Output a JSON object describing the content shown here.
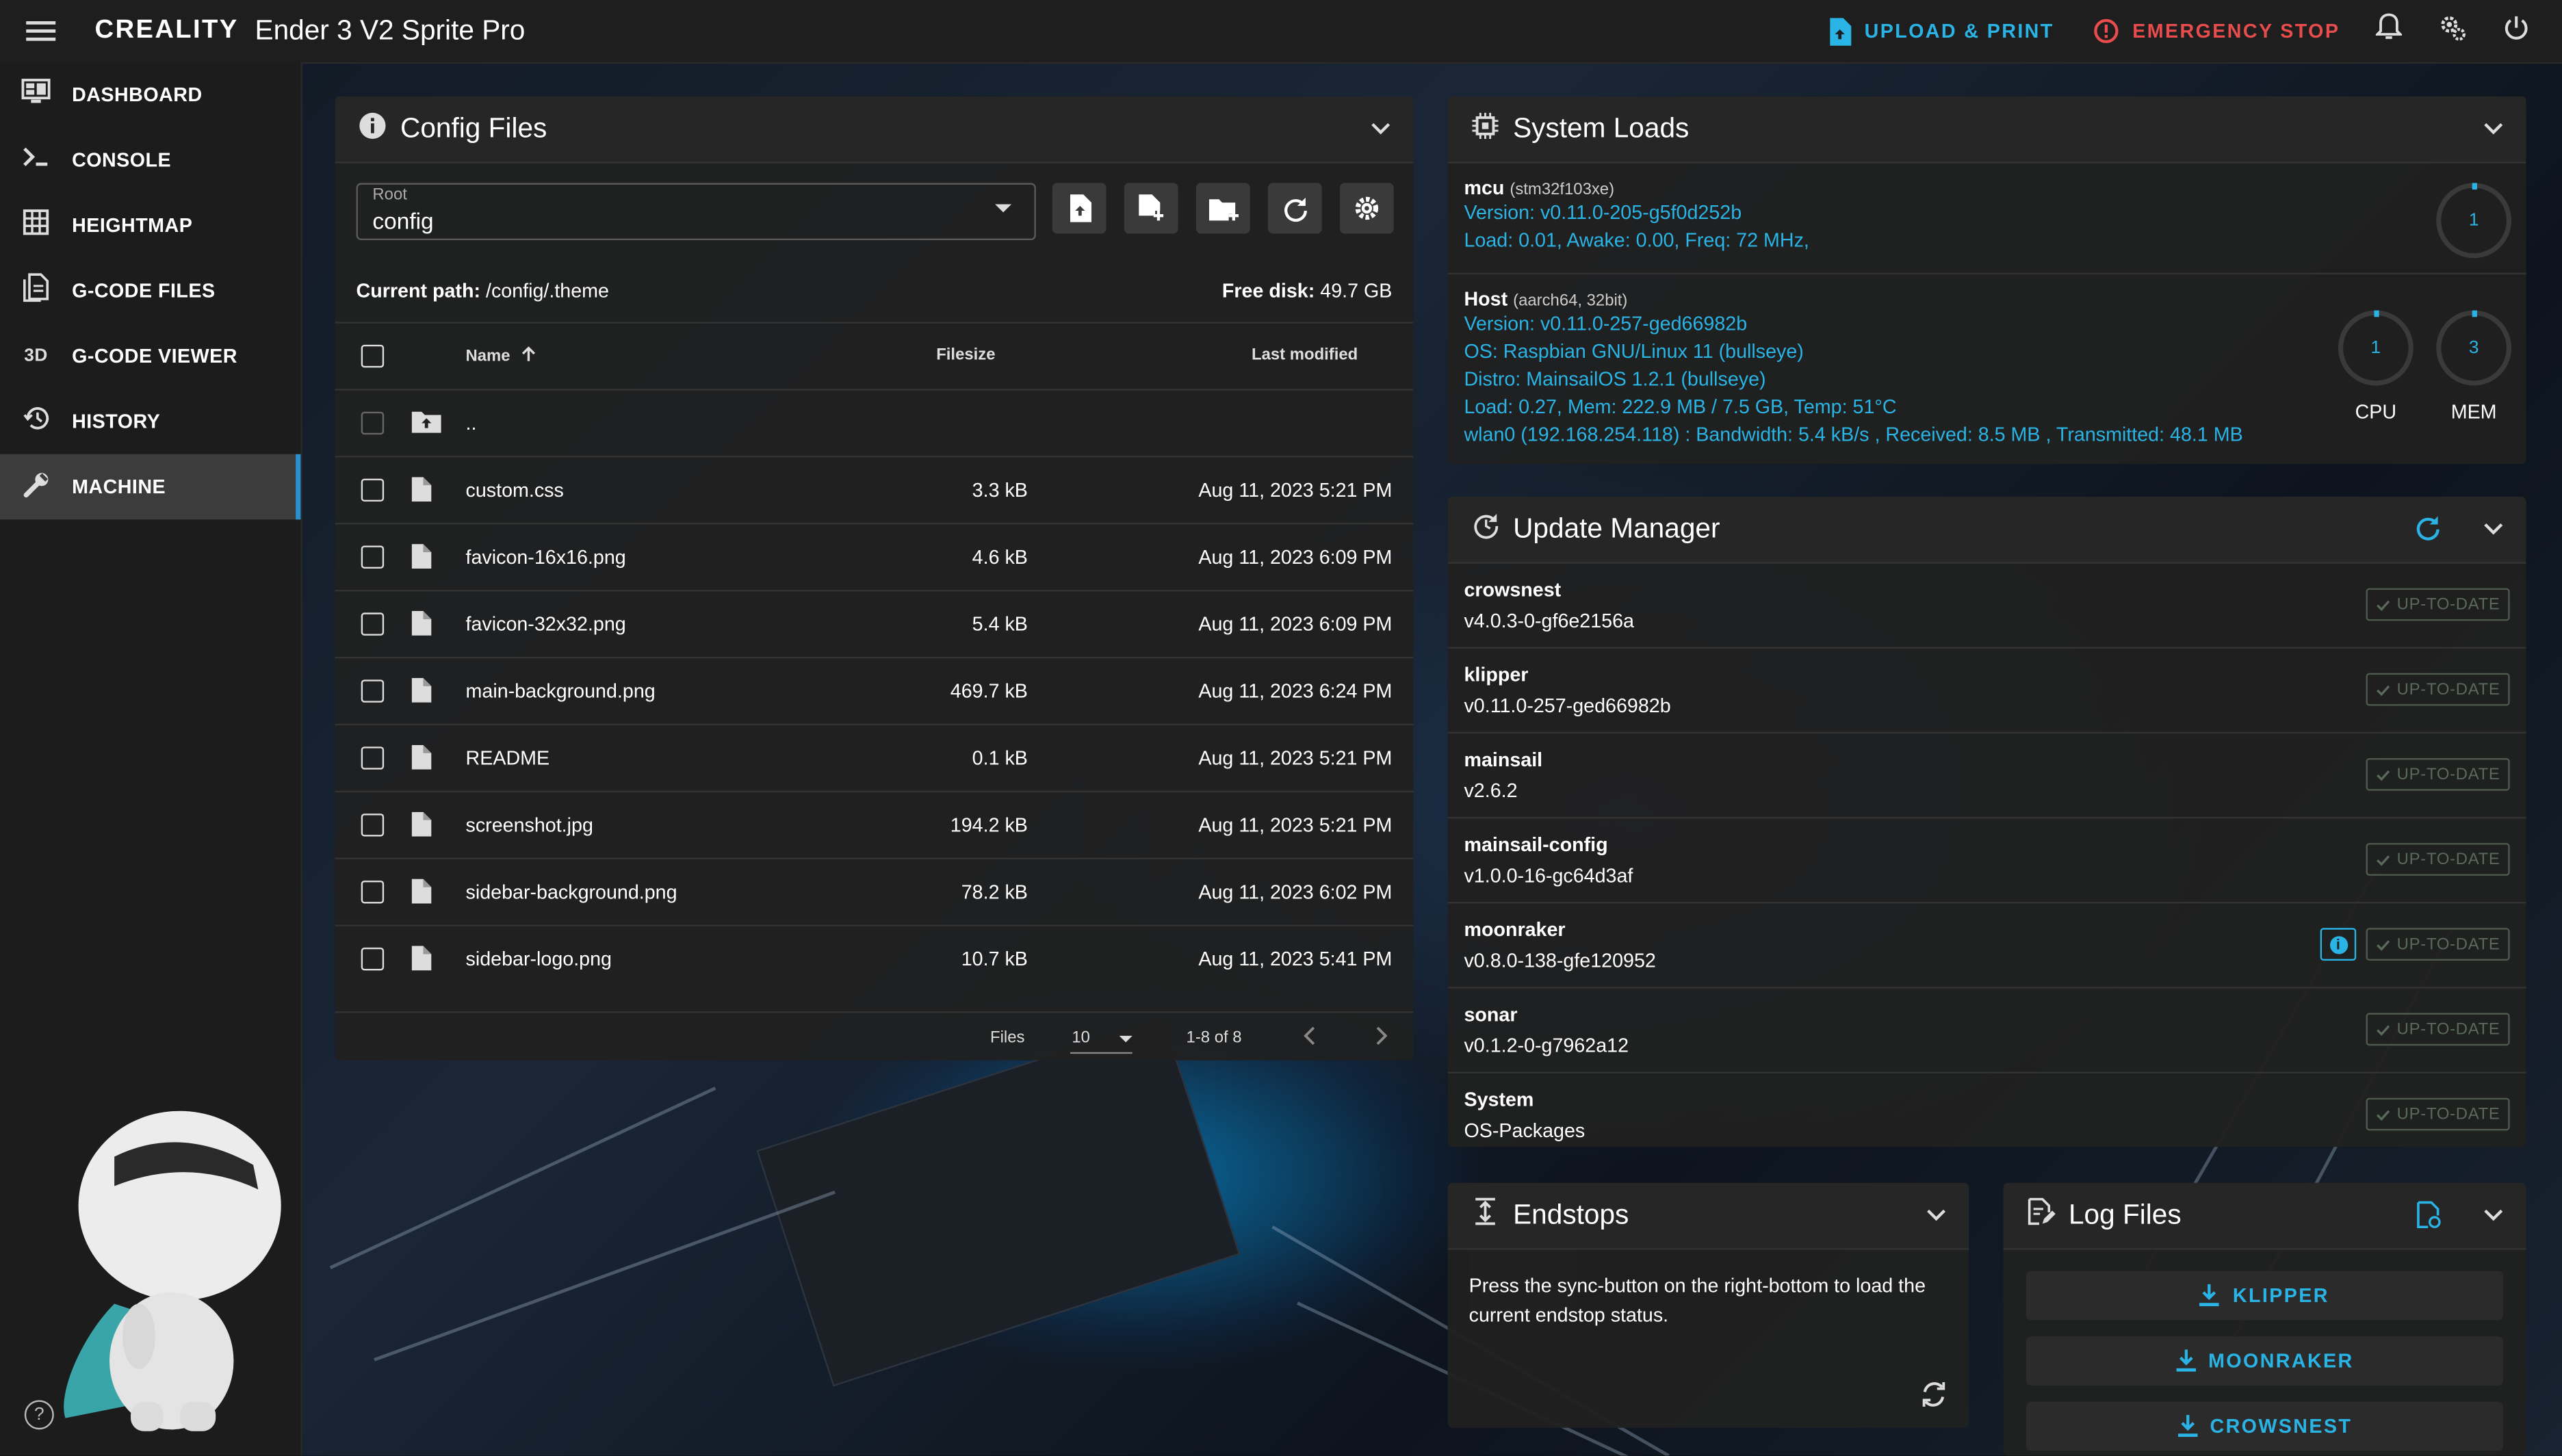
{
  "topbar": {
    "brand": "CREALITY",
    "printer_name": "Ender 3 V2 Sprite Pro",
    "upload_label": "UPLOAD & PRINT",
    "estop_label": "EMERGENCY STOP"
  },
  "sidebar": {
    "items": [
      {
        "label": "DASHBOARD",
        "icon": "monitor-dashboard-icon"
      },
      {
        "label": "CONSOLE",
        "icon": "console-icon"
      },
      {
        "label": "HEIGHTMAP",
        "icon": "grid-icon"
      },
      {
        "label": "G-CODE FILES",
        "icon": "file-document-icon"
      },
      {
        "label": "G-CODE VIEWER",
        "icon": "3d-icon"
      },
      {
        "label": "HISTORY",
        "icon": "history-icon"
      },
      {
        "label": "MACHINE",
        "icon": "wrench-icon"
      }
    ],
    "active": "MACHINE",
    "icon_3d_text": "3D"
  },
  "config_files": {
    "title": "Config Files",
    "root_label": "Root",
    "root_value": "config",
    "current_path_label": "Current path:",
    "current_path": "/config/.theme",
    "free_disk_label": "Free disk:",
    "free_disk": "49.7 GB",
    "columns": {
      "name": "Name",
      "size": "Filesize",
      "modified": "Last modified"
    },
    "parent_dir": "..",
    "files": [
      {
        "name": "custom.css",
        "size": "3.3 kB",
        "modified": "Aug 11, 2023 5:21 PM"
      },
      {
        "name": "favicon-16x16.png",
        "size": "4.6 kB",
        "modified": "Aug 11, 2023 6:09 PM"
      },
      {
        "name": "favicon-32x32.png",
        "size": "5.4 kB",
        "modified": "Aug 11, 2023 6:09 PM"
      },
      {
        "name": "main-background.png",
        "size": "469.7 kB",
        "modified": "Aug 11, 2023 6:24 PM"
      },
      {
        "name": "README",
        "size": "0.1 kB",
        "modified": "Aug 11, 2023 5:21 PM"
      },
      {
        "name": "screenshot.jpg",
        "size": "194.2 kB",
        "modified": "Aug 11, 2023 5:21 PM"
      },
      {
        "name": "sidebar-background.png",
        "size": "78.2 kB",
        "modified": "Aug 11, 2023 6:02 PM"
      },
      {
        "name": "sidebar-logo.png",
        "size": "10.7 kB",
        "modified": "Aug 11, 2023 5:41 PM"
      }
    ],
    "footer": {
      "files_label": "Files",
      "per_page": "10",
      "range": "1-8 of 8"
    }
  },
  "system_loads": {
    "title": "System Loads",
    "mcu": {
      "name": "mcu",
      "chip": "(stm32f103xe)",
      "version": "Version: v0.11.0-205-g5f0d252b",
      "load": "Load: 0.01, Awake: 0.00, Freq: 72 MHz,",
      "gauge": "1"
    },
    "host": {
      "name": "Host",
      "arch": "(aarch64, 32bit)",
      "version": "Version: v0.11.0-257-ged66982b",
      "os": "OS: Raspbian GNU/Linux 11 (bullseye)",
      "distro": "Distro: MainsailOS 1.2.1 (bullseye)",
      "load": "Load: 0.27, Mem: 222.9 MB / 7.5 GB, Temp: 51°C",
      "net": "wlan0 (192.168.254.118) : Bandwidth: 5.4 kB/s , Received: 8.5 MB , Transmitted: 48.1 MB",
      "cpu_value": "1",
      "cpu_label": "CPU",
      "mem_value": "3",
      "mem_label": "MEM"
    }
  },
  "update_manager": {
    "title": "Update Manager",
    "status_label": "UP-TO-DATE",
    "items": [
      {
        "name": "crowsnest",
        "version": "v4.0.3-0-gf6e2156a"
      },
      {
        "name": "klipper",
        "version": "v0.11.0-257-ged66982b"
      },
      {
        "name": "mainsail",
        "version": "v2.6.2"
      },
      {
        "name": "mainsail-config",
        "version": "v1.0.0-16-gc64d3af"
      },
      {
        "name": "moonraker",
        "version": "v0.8.0-138-gfe120952"
      },
      {
        "name": "sonar",
        "version": "v0.1.2-0-g7962a12"
      },
      {
        "name": "System",
        "version": "OS-Packages"
      }
    ]
  },
  "endstops": {
    "title": "Endstops",
    "message": "Press the sync-button on the right-bottom to load the current endstop status."
  },
  "log_files": {
    "title": "Log Files",
    "buttons": [
      "KLIPPER",
      "MOONRAKER",
      "CROWSNEST"
    ]
  },
  "colors": {
    "accent": "#2ab4e6",
    "danger": "#e84c4c",
    "panel": "#202020"
  }
}
